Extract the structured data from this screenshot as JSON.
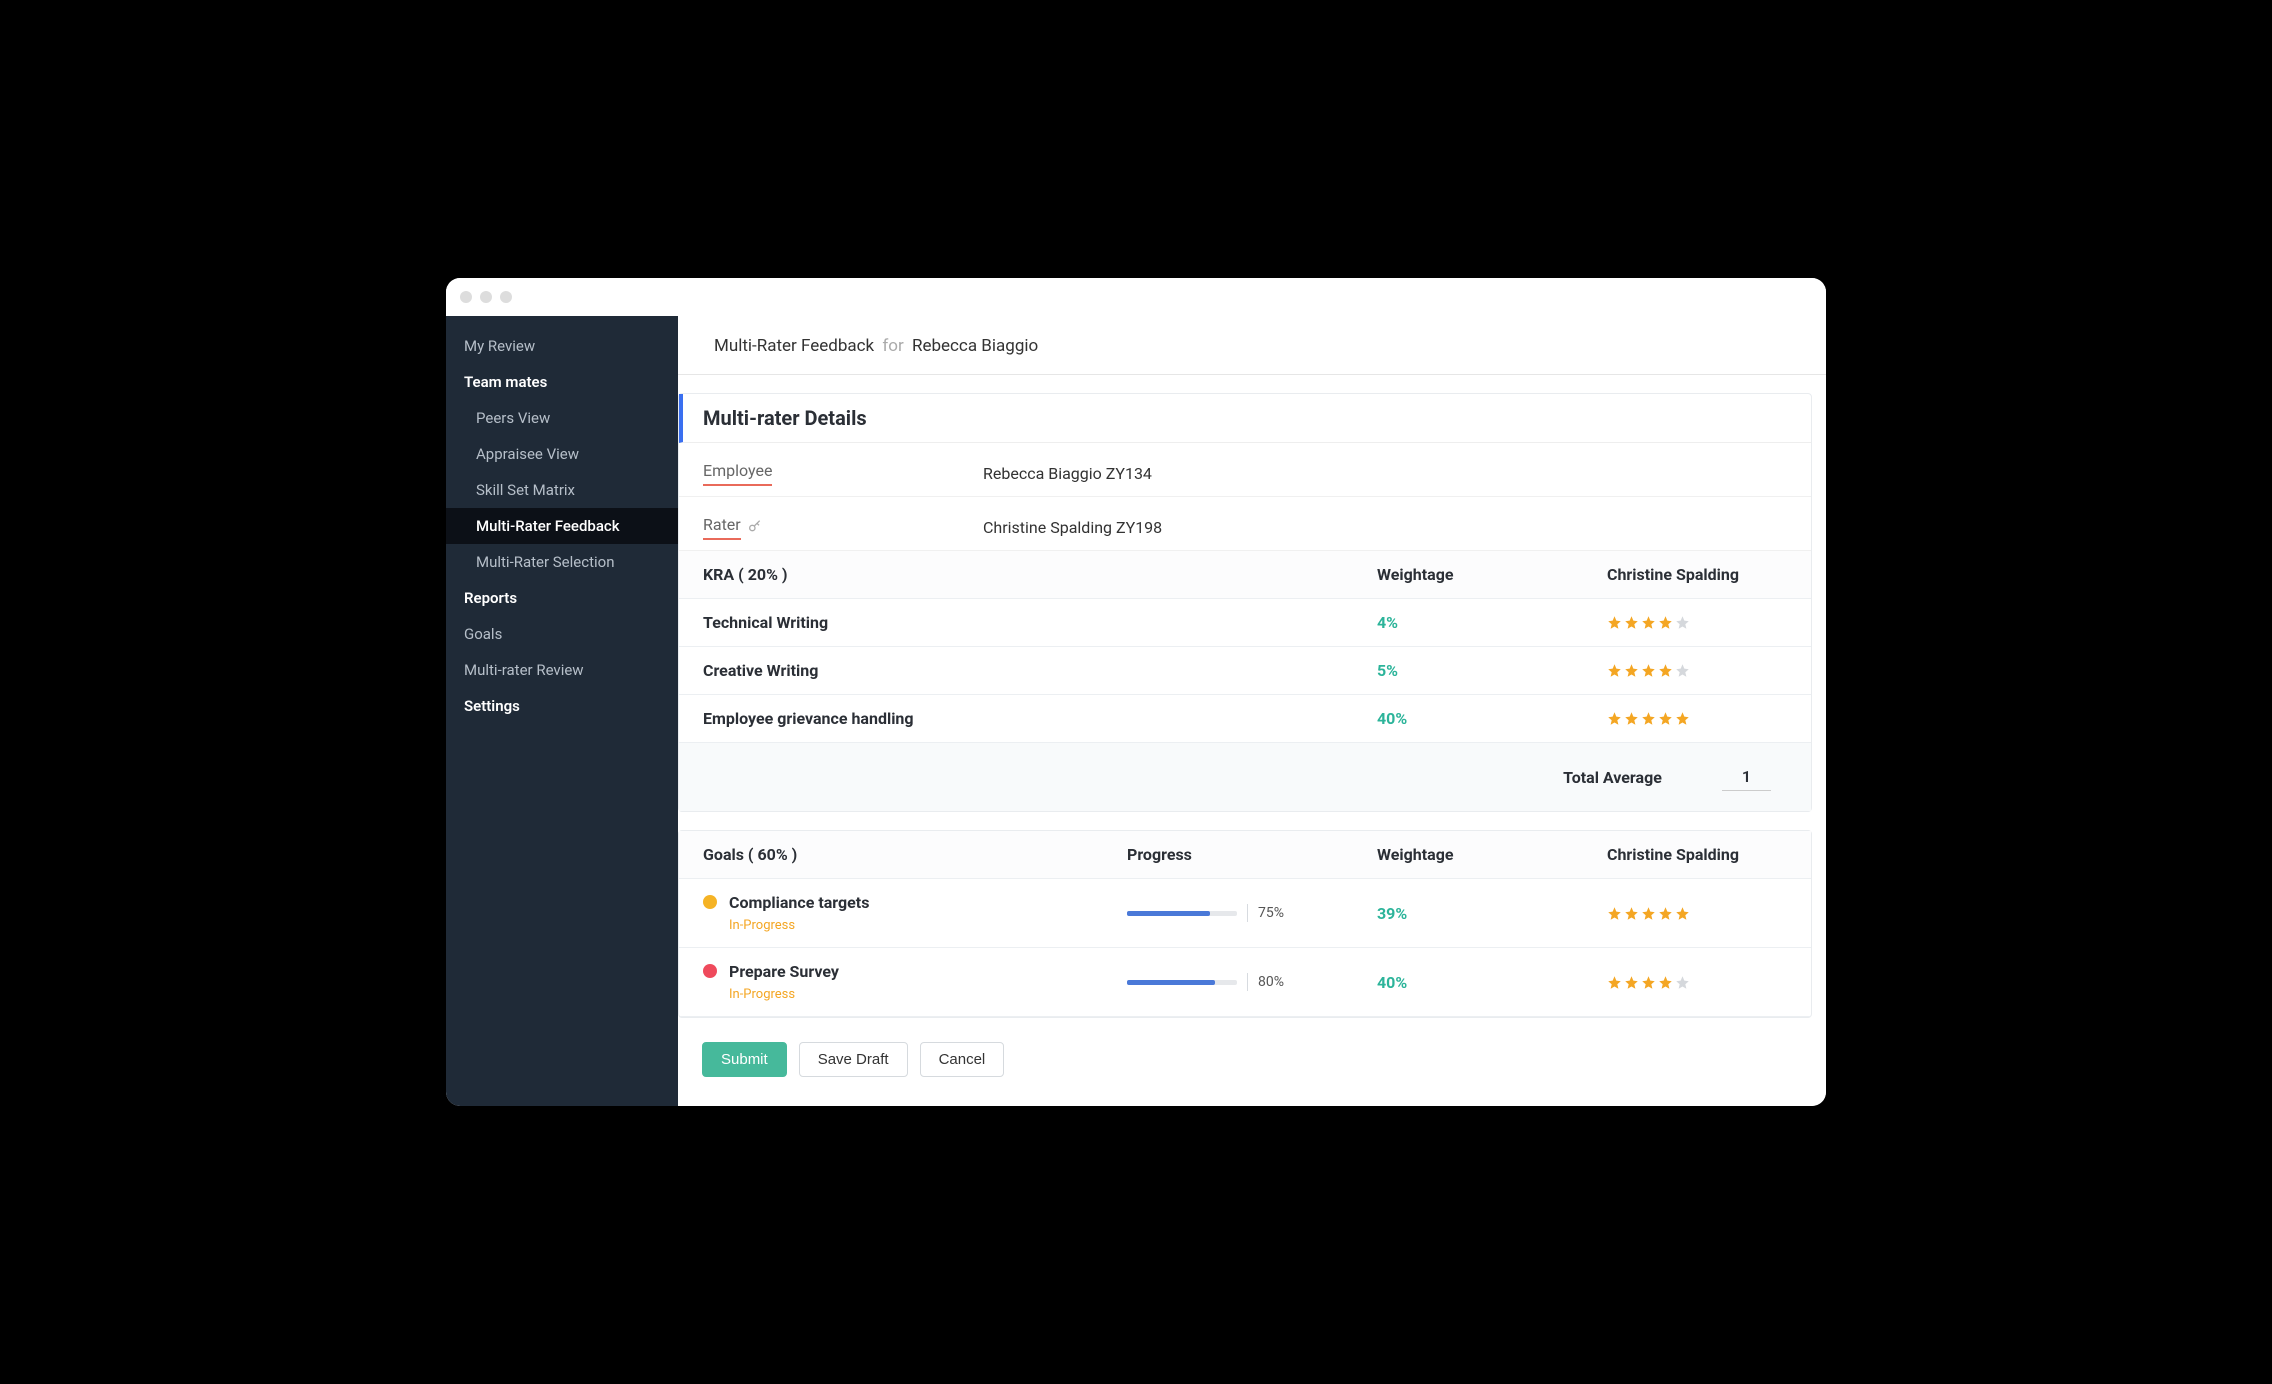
{
  "sidebar": {
    "items": [
      {
        "label": "My Review",
        "type": "link"
      },
      {
        "label": "Team mates",
        "type": "section"
      },
      {
        "label": "Peers View",
        "type": "sub"
      },
      {
        "label": "Appraisee View",
        "type": "sub"
      },
      {
        "label": "Skill Set Matrix",
        "type": "sub"
      },
      {
        "label": "Multi-Rater Feedback",
        "type": "sub",
        "active": true
      },
      {
        "label": "Multi-Rater Selection",
        "type": "sub"
      },
      {
        "label": "Reports",
        "type": "section"
      },
      {
        "label": "Goals",
        "type": "link"
      },
      {
        "label": "Multi-rater Review",
        "type": "link"
      },
      {
        "label": "Settings",
        "type": "section"
      }
    ]
  },
  "breadcrumb": {
    "title": "Multi-Rater Feedback",
    "for": "for",
    "person": "Rebecca Biaggio"
  },
  "section_title": "Multi-rater Details",
  "meta": {
    "employee_label": "Employee",
    "employee_value": "Rebecca Biaggio ZY134",
    "rater_label": "Rater",
    "rater_value": "Christine Spalding ZY198"
  },
  "kra": {
    "header": "KRA ( 20% )",
    "weightage_header": "Weightage",
    "rater_header": "Christine Spalding",
    "rows": [
      {
        "name": "Technical Writing",
        "weight": "4%",
        "stars": 4
      },
      {
        "name": "Creative Writing",
        "weight": "5%",
        "stars": 4
      },
      {
        "name": "Employee grievance handling",
        "weight": "40%",
        "stars": 5
      }
    ],
    "total_label": "Total Average",
    "total_value": "1"
  },
  "goals": {
    "header": "Goals ( 60% )",
    "progress_header": "Progress",
    "weightage_header": "Weightage",
    "rater_header": "Christine Spalding",
    "rows": [
      {
        "name": "Compliance targets",
        "status": "In-Progress",
        "dot": "#f5b325",
        "progress": 75,
        "progress_label": "75%",
        "weight": "39%",
        "stars": 5
      },
      {
        "name": "Prepare Survey",
        "status": "In-Progress",
        "dot": "#ef4a5c",
        "progress": 80,
        "progress_label": "80%",
        "weight": "40%",
        "stars": 4
      }
    ]
  },
  "actions": {
    "submit": "Submit",
    "save_draft": "Save Draft",
    "cancel": "Cancel"
  }
}
